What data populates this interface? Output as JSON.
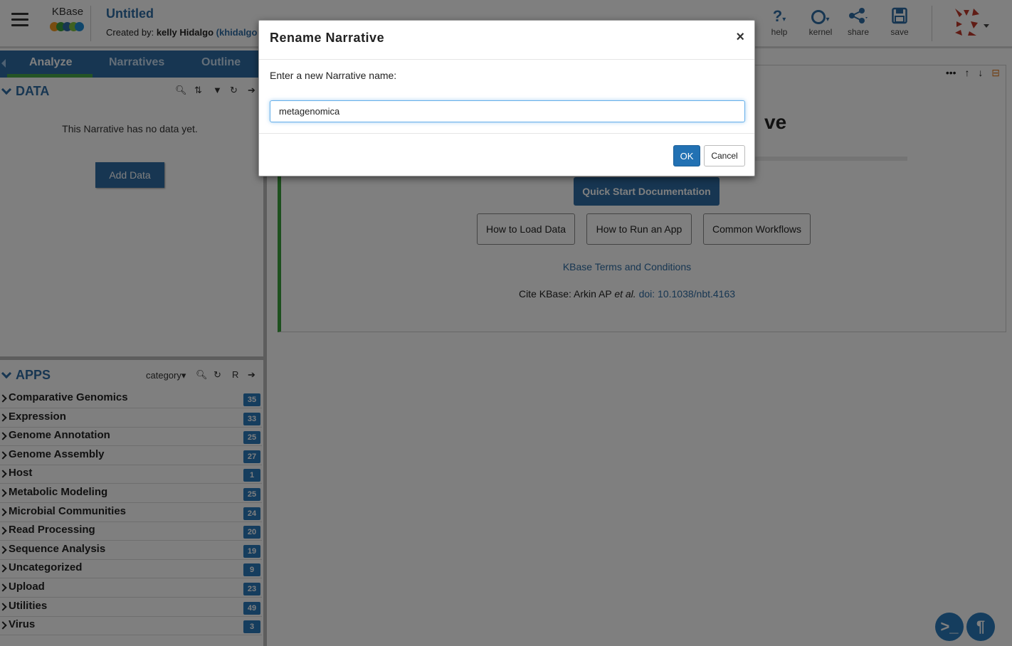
{
  "header": {
    "logo_text": "KBase",
    "narrative_title": "Untitled",
    "created_by_label": "Created by:",
    "owner_name": "kelly Hidalgo",
    "owner_username": "(khidalgo",
    "buttons": [
      {
        "label": "help",
        "icon": "help-icon"
      },
      {
        "label": "kernel",
        "icon": "kernel-icon"
      },
      {
        "label": "share",
        "icon": "share-icon"
      },
      {
        "label": "save",
        "icon": "save-icon"
      }
    ]
  },
  "tabs": [
    {
      "label": "Analyze",
      "active": true
    },
    {
      "label": "Narratives",
      "active": false
    },
    {
      "label": "Outline",
      "active": false
    }
  ],
  "data_panel": {
    "title": "DATA",
    "empty_message": "This Narrative has no data yet.",
    "add_button": "Add Data"
  },
  "apps_panel": {
    "title": "APPS",
    "category_label": "category",
    "r_label": "R",
    "categories": [
      {
        "name": "Comparative Genomics",
        "count": "35"
      },
      {
        "name": "Expression",
        "count": "33"
      },
      {
        "name": "Genome Annotation",
        "count": "25"
      },
      {
        "name": "Genome Assembly",
        "count": "27"
      },
      {
        "name": "Host",
        "count": "1"
      },
      {
        "name": "Metabolic Modeling",
        "count": "25"
      },
      {
        "name": "Microbial Communities",
        "count": "24"
      },
      {
        "name": "Read Processing",
        "count": "20"
      },
      {
        "name": "Sequence Analysis",
        "count": "19"
      },
      {
        "name": "Uncategorized",
        "count": "9"
      },
      {
        "name": "Upload",
        "count": "23"
      },
      {
        "name": "Utilities",
        "count": "49"
      },
      {
        "name": "Virus",
        "count": "3"
      }
    ]
  },
  "main_cell": {
    "heading_fragment": "ve",
    "quick_start": "Quick Start Documentation",
    "links": [
      "How to Load Data",
      "How to Run an App",
      "Common Workflows"
    ],
    "terms": "KBase Terms and Conditions",
    "cite_prefix": "Cite KBase: Arkin AP ",
    "cite_etal": "et al.",
    "cite_doi": "doi: 10.1038/nbt.4163"
  },
  "modal": {
    "title": "Rename Narrative",
    "close": "×",
    "prompt": "Enter a new Narrative name:",
    "input_value": "metagenomica",
    "ok": "OK",
    "cancel": "Cancel"
  },
  "colors": {
    "kbase_blue": "#2e6da4",
    "active_tab_underline": "#48a84a",
    "cell_border": "#3aa13d",
    "badge": "#2a7bbd"
  }
}
